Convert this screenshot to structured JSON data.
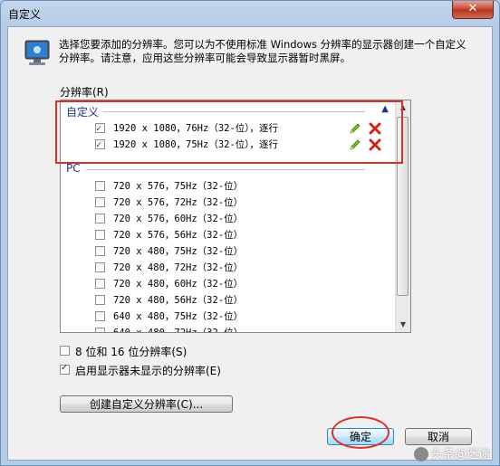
{
  "window": {
    "title": "自定义",
    "close_label": "✕"
  },
  "intro_text": "选择您要添加的分辨率。您可以为不使用标准 Windows 分辨率的显示器创建一个自定义分辨率。请注意，应用这些分辨率可能会导致显示器暂时黑屏。",
  "resolution_group_label": "分辨率(R)",
  "groups": [
    {
      "name": "自定义",
      "items": [
        {
          "label": "1920 x 1080，76Hz（32-位），逐行",
          "checked": true
        },
        {
          "label": "1920 x 1080，75Hz（32-位），逐行",
          "checked": true
        }
      ]
    },
    {
      "name": "PC",
      "items": [
        {
          "label": "720 x 576，75Hz（32-位）",
          "checked": false
        },
        {
          "label": "720 x 576，72Hz（32-位）",
          "checked": false
        },
        {
          "label": "720 x 576，60Hz（32-位）",
          "checked": false
        },
        {
          "label": "720 x 576，56Hz（32-位）",
          "checked": false
        },
        {
          "label": "720 x 480，75Hz（32-位）",
          "checked": false
        },
        {
          "label": "720 x 480，72Hz（32-位）",
          "checked": false
        },
        {
          "label": "720 x 480，60Hz（32-位）",
          "checked": false
        },
        {
          "label": "720 x 480，56Hz（32-位）",
          "checked": false
        },
        {
          "label": "640 x 480，75Hz（32-位）",
          "checked": false
        },
        {
          "label": "640 x 480，72Hz（32-位）",
          "checked": false
        }
      ]
    }
  ],
  "options": {
    "low_color": {
      "label": "8 位和 16 位分辨率(S)",
      "checked": false
    },
    "hidden_modes": {
      "label": "启用显示器未显示的分辨率(E)",
      "checked": true
    }
  },
  "buttons": {
    "create_custom": "创建自定义分辨率(C)...",
    "ok": "确定",
    "cancel": "取消"
  },
  "watermark": "头条@迷途"
}
